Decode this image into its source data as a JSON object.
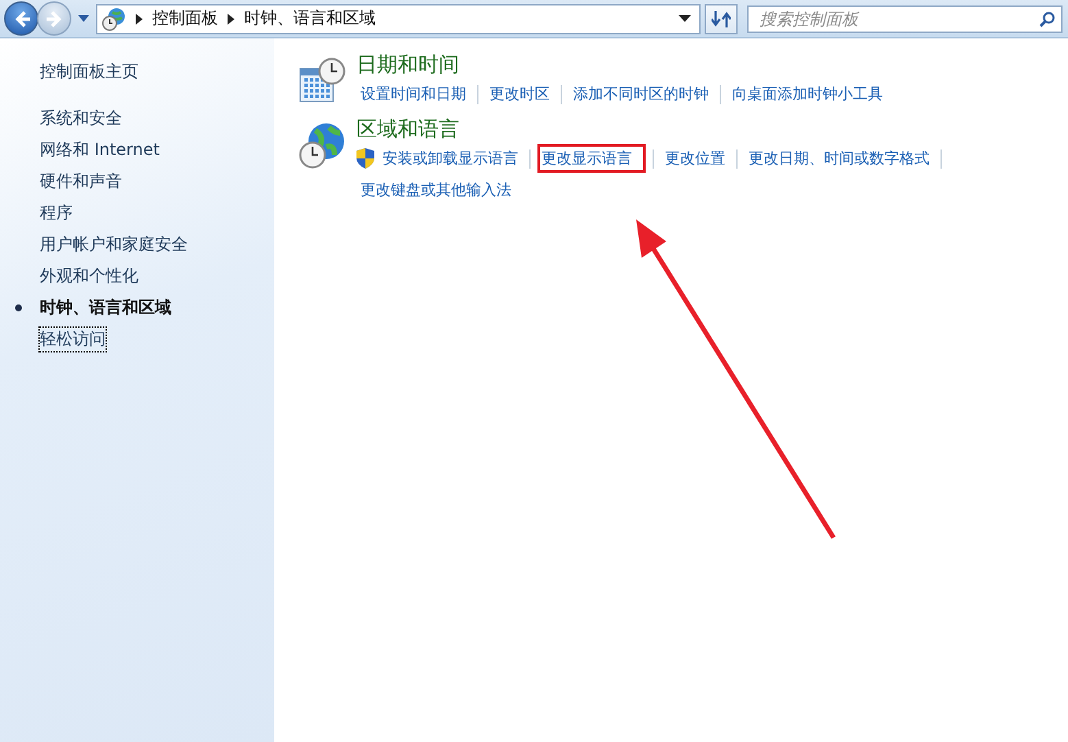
{
  "address_bar": {
    "breadcrumbs": [
      "控制面板",
      "时钟、语言和区域"
    ]
  },
  "search": {
    "placeholder": "搜索控制面板"
  },
  "sidebar": {
    "home": "控制面板主页",
    "items": [
      {
        "label": "系统和安全",
        "selected": false,
        "focused": false
      },
      {
        "label": "网络和 Internet",
        "selected": false,
        "focused": false
      },
      {
        "label": "硬件和声音",
        "selected": false,
        "focused": false
      },
      {
        "label": "程序",
        "selected": false,
        "focused": false
      },
      {
        "label": "用户帐户和家庭安全",
        "selected": false,
        "focused": false
      },
      {
        "label": "外观和个性化",
        "selected": false,
        "focused": false
      },
      {
        "label": "时钟、语言和区域",
        "selected": true,
        "focused": false
      },
      {
        "label": "轻松访问",
        "selected": false,
        "focused": true
      }
    ]
  },
  "categories": [
    {
      "kind": "clock",
      "title": "日期和时间",
      "links": [
        {
          "label": "设置时间和日期",
          "shield": false,
          "highlighted": false
        },
        {
          "label": "更改时区",
          "shield": false,
          "highlighted": false
        },
        {
          "label": "添加不同时区的时钟",
          "shield": false,
          "highlighted": false
        },
        {
          "label": "向桌面添加时钟小工具",
          "shield": false,
          "highlighted": false
        }
      ]
    },
    {
      "kind": "globe",
      "title": "区域和语言",
      "links": [
        {
          "label": "安装或卸载显示语言",
          "shield": true,
          "highlighted": false
        },
        {
          "label": "更改显示语言",
          "shield": false,
          "highlighted": true
        },
        {
          "label": "更改位置",
          "shield": false,
          "highlighted": false
        },
        {
          "label": "更改日期、时间或数字格式",
          "shield": false,
          "highlighted": false
        },
        {
          "label": "更改键盘或其他输入法",
          "shield": false,
          "highlighted": false
        }
      ]
    }
  ]
}
